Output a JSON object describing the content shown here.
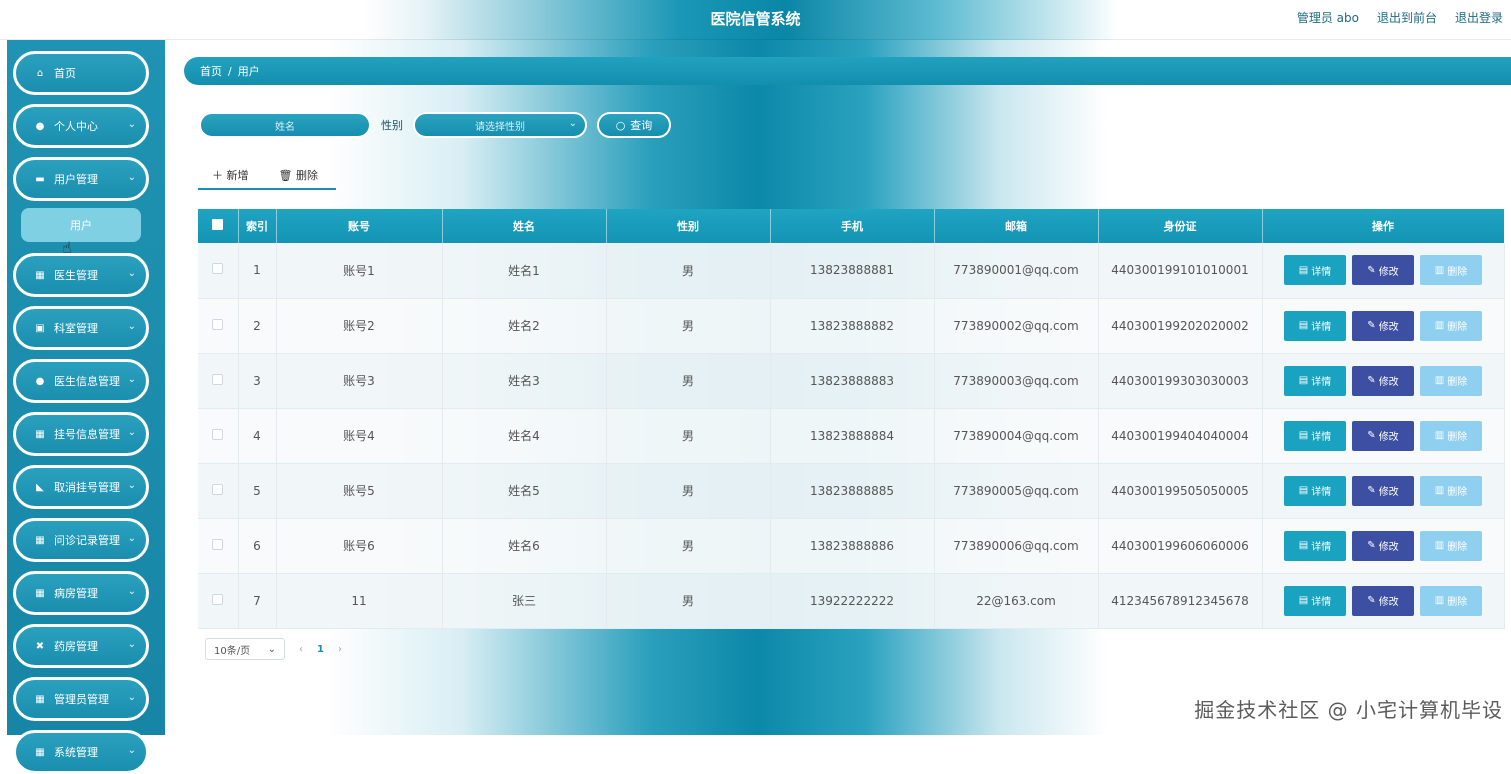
{
  "app": {
    "title": "医院信管系统",
    "user_label": "管理员 abo",
    "back_to_front": "退出到前台",
    "logout": "退出登录"
  },
  "sidebar": {
    "items": [
      {
        "label": "首页",
        "icon": "home-icon",
        "has_chevron": false
      },
      {
        "label": "个人中心",
        "icon": "user-icon",
        "has_chevron": true
      },
      {
        "label": "用户管理",
        "icon": "folder-icon",
        "has_chevron": true
      },
      {
        "label": "医生管理",
        "icon": "grid-icon",
        "has_chevron": true
      },
      {
        "label": "科室管理",
        "icon": "book-icon",
        "has_chevron": true
      },
      {
        "label": "医生信息管理",
        "icon": "person-icon",
        "has_chevron": true
      },
      {
        "label": "挂号信息管理",
        "icon": "grid-icon",
        "has_chevron": true
      },
      {
        "label": "取消挂号管理",
        "icon": "thumb-icon",
        "has_chevron": true
      },
      {
        "label": "问诊记录管理",
        "icon": "grid-icon",
        "has_chevron": true
      },
      {
        "label": "病房管理",
        "icon": "grid-icon",
        "has_chevron": true
      },
      {
        "label": "药房管理",
        "icon": "cross-icon",
        "has_chevron": true
      },
      {
        "label": "管理员管理",
        "icon": "grid-icon",
        "has_chevron": true
      },
      {
        "label": "系统管理",
        "icon": "grid-icon",
        "has_chevron": true
      }
    ],
    "submenu_active": "用户"
  },
  "breadcrumb": {
    "home": "首页",
    "sep": "/",
    "current": "用户"
  },
  "search": {
    "name_placeholder": "姓名",
    "sex_label": "性别",
    "sex_placeholder": "请选择性别",
    "query_label": "查询"
  },
  "toolbar": {
    "add_label": "新增",
    "delete_label": "删除"
  },
  "table": {
    "headers": [
      "索引",
      "账号",
      "姓名",
      "性别",
      "手机",
      "邮箱",
      "身份证",
      "操作"
    ],
    "rows": [
      {
        "index": "1",
        "account": "账号1",
        "name": "姓名1",
        "sex": "男",
        "phone": "13823888881",
        "email": "773890001@qq.com",
        "id_card": "440300199101010001"
      },
      {
        "index": "2",
        "account": "账号2",
        "name": "姓名2",
        "sex": "男",
        "phone": "13823888882",
        "email": "773890002@qq.com",
        "id_card": "440300199202020002"
      },
      {
        "index": "3",
        "account": "账号3",
        "name": "姓名3",
        "sex": "男",
        "phone": "13823888883",
        "email": "773890003@qq.com",
        "id_card": "440300199303030003"
      },
      {
        "index": "4",
        "account": "账号4",
        "name": "姓名4",
        "sex": "男",
        "phone": "13823888884",
        "email": "773890004@qq.com",
        "id_card": "440300199404040004"
      },
      {
        "index": "5",
        "account": "账号5",
        "name": "姓名5",
        "sex": "男",
        "phone": "13823888885",
        "email": "773890005@qq.com",
        "id_card": "440300199505050005"
      },
      {
        "index": "6",
        "account": "账号6",
        "name": "姓名6",
        "sex": "男",
        "phone": "13823888886",
        "email": "773890006@qq.com",
        "id_card": "440300199606060006"
      },
      {
        "index": "7",
        "account": "11",
        "name": "张三",
        "sex": "男",
        "phone": "13922222222",
        "email": "22@163.com",
        "id_card": "412345678912345678"
      }
    ],
    "actions": {
      "detail": "详情",
      "edit": "修改",
      "delete": "删除"
    }
  },
  "pagination": {
    "page_size": "10条/页",
    "current_page": "1"
  },
  "watermark": "掘金技术社区 @ 小宅计算机毕设",
  "colors": {
    "primary": "#1a97b6",
    "edit": "#3d4fa3",
    "delete": "#8fcff0",
    "detail": "#19a3c0"
  }
}
